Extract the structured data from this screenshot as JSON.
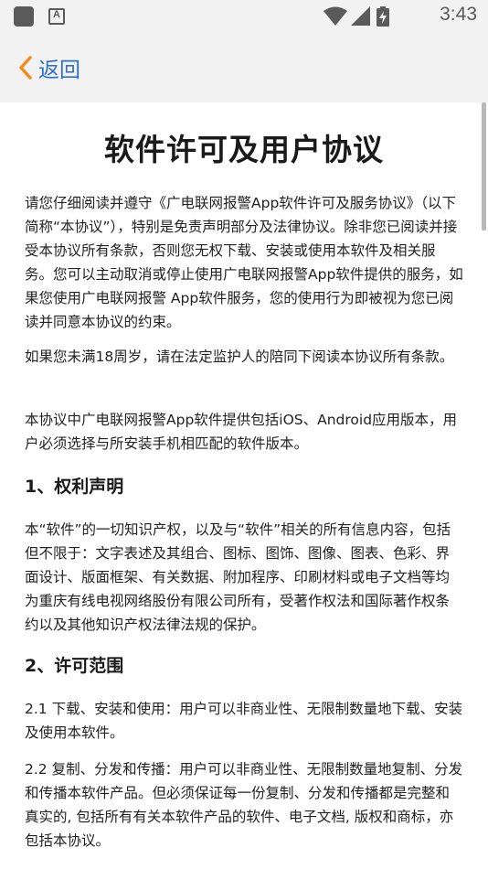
{
  "status_bar": {
    "time": "3:43",
    "a_badge": "A",
    "icons": [
      "app-square-icon",
      "a-badge-icon",
      "wifi-icon",
      "signal-icon",
      "battery-charging-icon"
    ]
  },
  "nav": {
    "back_label": "返回",
    "accent_color": "#2f6fc8",
    "chevron_color": "#f08c1e"
  },
  "doc": {
    "title": "软件许可及用户协议",
    "p1": "请您仔细阅读并遵守《广电联网报警App软件许可及服务协议》（以下简称“本协议”），特别是免责声明部分及法律协议。除非您已阅读并接受本协议所有条款，否则您无权下载、安装或使用本软件及相关服务。您可以主动取消或停止使用广电联网报警App软件提供的服务，如果您使用广电联网报警 App软件服务，您的使用行为即被视为您已阅读并同意本协议的约束。",
    "p2": "如果您未满18周岁，请在法定监护人的陪同下阅读本协议所有条款。",
    "p3": "本协议中广电联网报警App软件提供包括iOS、Android应用版本，用户必须选择与所安装手机相匹配的软件版本。",
    "h1": "1、权利声明",
    "p4": "本“软件”的一切知识产权，以及与“软件”相关的所有信息内容，包括但不限于：文字表述及其组合、图标、图饰、图像、图表、色彩、界面设计、版面框架、有关数据、附加程序、印刷材料或电子文档等均为重庆有线电视网络股份有限公司所有，受著作权法和国际著作权条约以及其他知识产权法律法规的保护。",
    "h2": "2、许可范围",
    "p5": "2.1 下载、安装和使用：用户可以非商业性、无限制数量地下载、安装及使用本软件。",
    "p6": "2.2 复制、分发和传播：用户可以非商业性、无限制数量地复制、分发和传播本软件产品。但必须保证每一份复制、分发和传播都是完整和真实的, 包括所有有关本软件产品的软件、电子文档, 版权和商标，亦包括本协议。"
  }
}
